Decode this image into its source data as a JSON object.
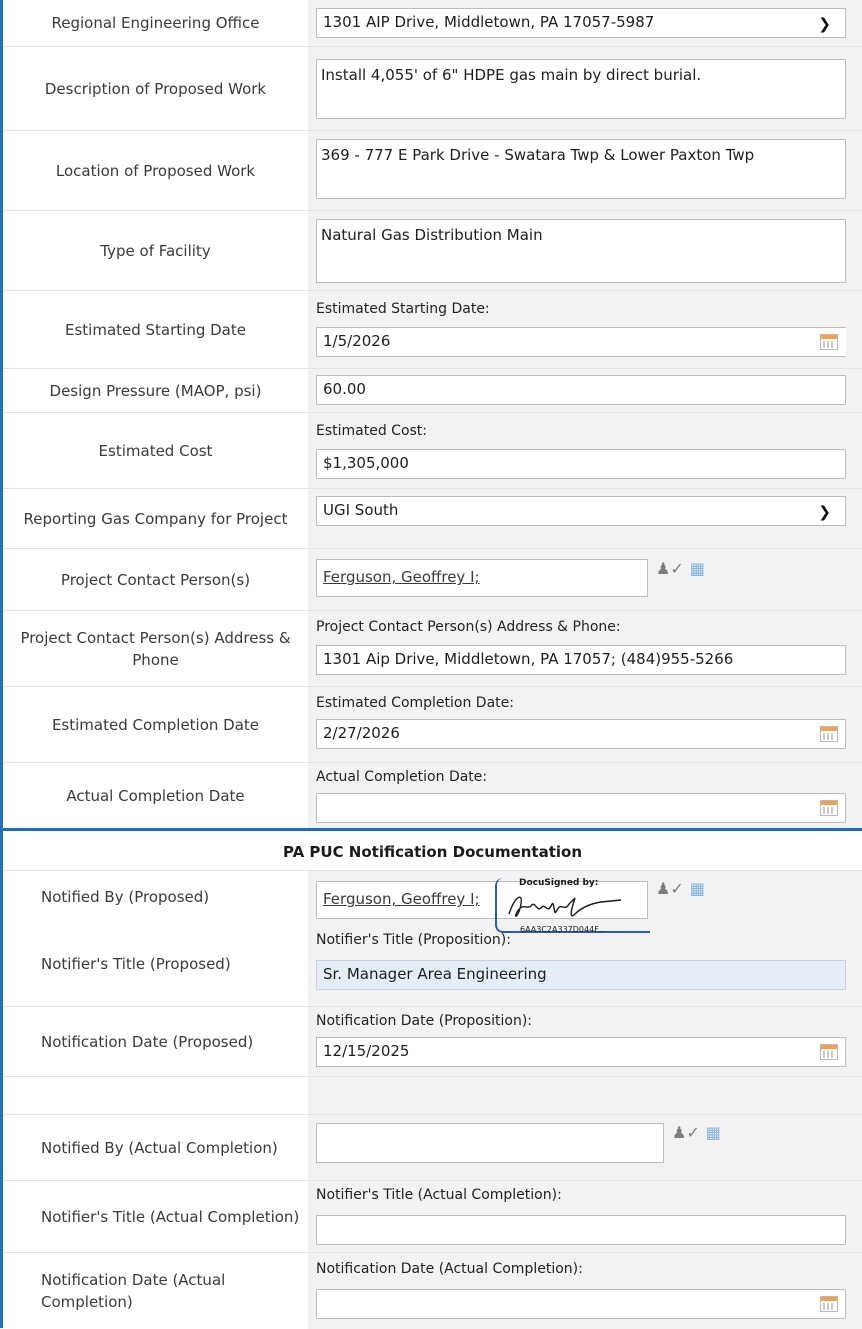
{
  "rows": {
    "office": {
      "label": "Regional Engineering Office",
      "value": "1301 AIP Drive, Middletown, PA 17057-5987"
    },
    "description": {
      "label": "Description of Proposed Work",
      "value": "Install 4,055' of 6\" HDPE gas main by direct burial."
    },
    "location": {
      "label": "Location of Proposed Work",
      "value": "369 - 777 E Park Drive -  Swatara Twp & Lower Paxton Twp"
    },
    "facility": {
      "label": "Type of Facility",
      "value": "Natural Gas Distribution Main"
    },
    "start_date": {
      "label": "Estimated Starting Date",
      "sublabel": "Estimated Starting Date:",
      "value": "1/5/2026"
    },
    "pressure": {
      "label": "Design Pressure (MAOP, psi)",
      "value": "60.00"
    },
    "cost": {
      "label": "Estimated Cost",
      "sublabel": "Estimated Cost:",
      "value": "$1,305,000"
    },
    "company": {
      "label": "Reporting Gas Company for Project",
      "value": "UGI South"
    },
    "contact": {
      "label": "Project Contact Person(s)",
      "value": "Ferguson, Geoffrey I;"
    },
    "contact_address": {
      "label": "Project Contact Person(s) Address & Phone",
      "sublabel": "Project Contact Person(s) Address & Phone:",
      "value": "1301 Aip Drive, Middletown, PA 17057; (484)955-5266"
    },
    "completion_est": {
      "label": "Estimated Completion Date",
      "sublabel": "Estimated Completion Date:",
      "value": "2/27/2026"
    },
    "completion_actual": {
      "label": "Actual Completion Date",
      "sublabel": "Actual Completion Date:",
      "value": ""
    }
  },
  "section_title": "PA PUC Notification Documentation",
  "notify": {
    "by_proposed": {
      "label": "Notified By (Proposed)",
      "value": "Ferguson, Geoffrey I;"
    },
    "title_proposed": {
      "label": "Notifier's Title (Proposed)",
      "sublabel": "Notifier's Title (Proposition):",
      "value": "Sr. Manager Area Engineering"
    },
    "date_proposed": {
      "label": "Notification Date (Proposed)",
      "sublabel": "Notification Date (Proposition):",
      "value": "12/15/2025"
    },
    "by_actual": {
      "label": "Notified By (Actual Completion)",
      "value": ""
    },
    "title_actual": {
      "label": "Notifier's Title (Actual Completion)",
      "sublabel": "Notifier's Title (Actual Completion):",
      "value": ""
    },
    "date_actual": {
      "label": "Notification Date (Actual Completion)",
      "sublabel": "Notification Date (Actual Completion):",
      "value": ""
    }
  },
  "signature": {
    "header": "DocuSigned by:",
    "id": "6AA3C2A337D044F..."
  },
  "icons": {
    "calendar": "calendar-icon",
    "dropdown": "chevron-down-icon",
    "address_book": "address-book-icon",
    "people_picker": "check-names-icon"
  },
  "colors": {
    "accent": "#1f6fbf",
    "readonly_field": "#e5eef8"
  }
}
